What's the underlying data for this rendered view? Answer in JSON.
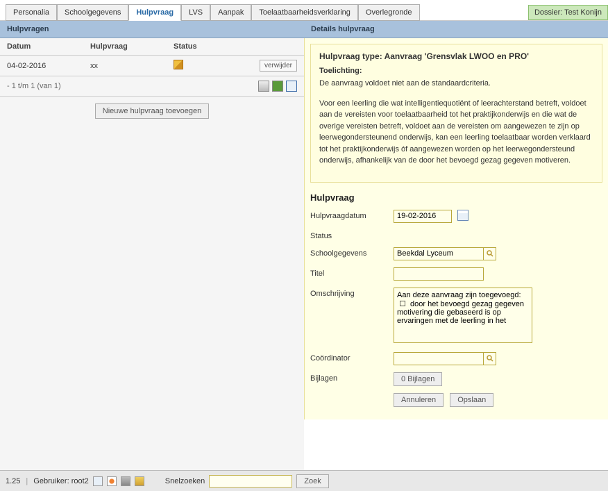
{
  "tabs": [
    "Personalia",
    "Schoolgegevens",
    "Hulpvraag",
    "LVS",
    "Aanpak",
    "Toelaatbaarheidsverklaring",
    "Overlegronde"
  ],
  "active_tab": 2,
  "dossier_label": "Dossier: Test Konijn",
  "left": {
    "header": "Hulpvragen",
    "columns": {
      "datum": "Datum",
      "hulpvraag": "Hulpvraag",
      "status": "Status"
    },
    "rows": [
      {
        "datum": "04-02-2016",
        "hulpvraag": "xx",
        "status": "",
        "verwijder": "verwijder"
      }
    ],
    "pager": "- 1 t/m 1 (van 1)",
    "new_button": "Nieuwe hulpvraag toevoegen"
  },
  "right": {
    "header": "Details hulpvraag",
    "info": {
      "title": "Hulpvraag type: Aanvraag 'Grensvlak LWOO en PRO'",
      "sub_label": "Toelichting:",
      "para1": "De aanvraag voldoet niet aan de standaardcriteria.",
      "para2": "Voor een leerling die wat intelligentiequotiënt of leerachterstand betreft, voldoet aan de vereisten voor toelaatbaarheid tot het praktijkonderwijs en die wat de overige vereisten betreft, voldoet aan de vereisten om aangewezen te zijn op leerwegondersteunend onderwijs, kan een leerling toelaatbaar worden verklaard tot het praktijkonderwijs óf aangewezen worden op het leerwegondersteund onderwijs, afhankelijk van de door het bevoegd gezag gegeven motiveren."
    },
    "section": "Hulpvraag",
    "form": {
      "hulpvraagdatum_label": "Hulpvraagdatum",
      "hulpvraagdatum_value": "19-02-2016",
      "status_label": "Status",
      "status_value": "",
      "schoolgegevens_label": "Schoolgegevens",
      "schoolgegevens_value": "Beekdal Lyceum",
      "titel_label": "Titel",
      "titel_value": "",
      "omschrijving_label": "Omschrijving",
      "omschrijving_value": "Aan deze aanvraag zijn toegevoegd:\n ☐  door het bevoegd gezag gegeven motivering die gebaseerd is op ervaringen met de leerling in het",
      "coordinator_label": "Coördinator",
      "coordinator_value": "",
      "bijlagen_label": "Bijlagen",
      "bijlagen_button": "0 Bijlagen",
      "annuleren": "Annuleren",
      "opslaan": "Opslaan"
    }
  },
  "bottom": {
    "version": "1.25",
    "user_label": "Gebruiker: root2",
    "quicksearch_label": "Snelzoeken",
    "quicksearch_value": "",
    "search_button": "Zoek"
  }
}
